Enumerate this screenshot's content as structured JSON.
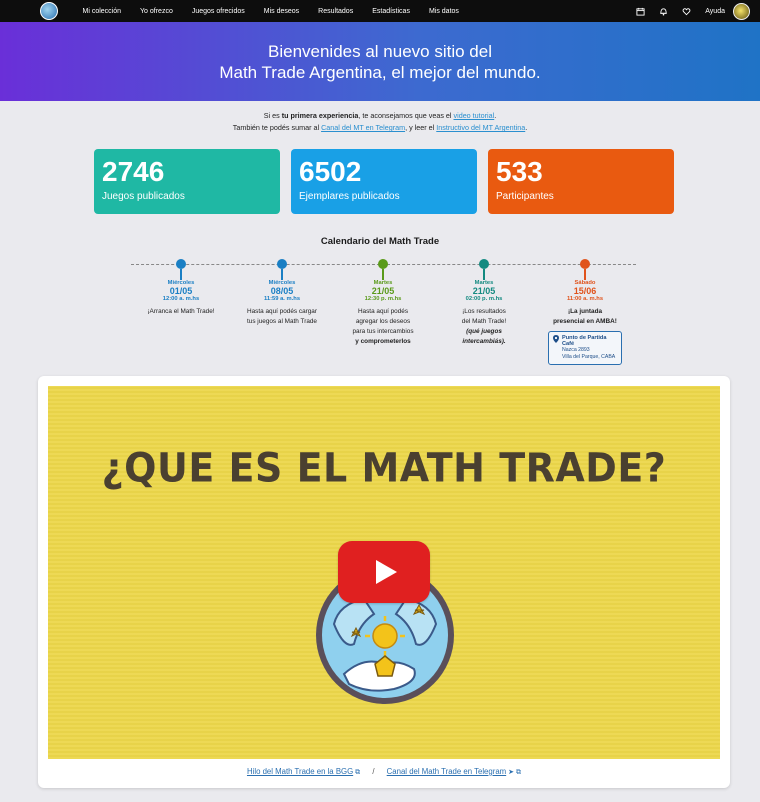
{
  "nav": {
    "items": [
      {
        "label": "Mi colección"
      },
      {
        "label": "Yo ofrezco"
      },
      {
        "label": "Juegos ofrecidos"
      },
      {
        "label": "Mis deseos"
      },
      {
        "label": "Resultados"
      },
      {
        "label": "Estadísticas"
      },
      {
        "label": "Mis datos"
      }
    ],
    "help_label": "Ayuda",
    "icons": [
      "calendar-icon",
      "bell-icon",
      "heart-icon"
    ]
  },
  "hero": {
    "line1": "Bienvenides al nuevo sitio del",
    "line2": "Math Trade Argentina, el mejor del mundo."
  },
  "intro": {
    "l1_a": "Si es ",
    "l1_b": "tu primera experiencia",
    "l1_c": ", te aconsejamos que veas el ",
    "l1_link": "video tutorial",
    "l1_d": ".",
    "l2_a": "También te podés sumar al ",
    "l2_link1": "Canal del MT en Telegram",
    "l2_b": ", y leer el ",
    "l2_link2": "Instructivo del MT Argentina",
    "l2_c": "."
  },
  "stats": [
    {
      "value": "2746",
      "label": "Juegos publicados",
      "color": "#1fb8a4"
    },
    {
      "value": "6502",
      "label": "Ejemplares publicados",
      "color": "#19a0e6"
    },
    {
      "value": "533",
      "label": "Participantes",
      "color": "#e95a10"
    }
  ],
  "calendar": {
    "title": "Calendario del Math Trade",
    "events": [
      {
        "day": "Miércoles",
        "date": "01/05",
        "time": "12:00 a. m.hs",
        "color": "#1a7fc4",
        "desc1": "¡Arranca el Math Trade!"
      },
      {
        "day": "Miércoles",
        "date": "08/05",
        "time": "11:59 a. m.hs",
        "color": "#1a7fc4",
        "desc1": "Hasta aquí podés cargar",
        "desc2": "tus juegos al Math Trade"
      },
      {
        "day": "Martes",
        "date": "21/05",
        "time": "12:30 p. m.hs",
        "color": "#5a9a1a",
        "desc1": "Hasta aquí podés",
        "desc2": "agregar los deseos",
        "desc3": "para tus intercambios",
        "desc4": "y comprometerlos"
      },
      {
        "day": "Martes",
        "date": "21/05",
        "time": "02:00 p. m.hs",
        "color": "#138a80",
        "desc1": "¡Los resultados",
        "desc2": "del Math Trade!",
        "desc3": "(qué juegos",
        "desc4": "intercambiás)."
      },
      {
        "day": "Sábado",
        "date": "15/06",
        "time": "11:00 a. m.hs",
        "color": "#e0531c",
        "desc1": "¡La juntada",
        "desc2": "presencial en AMBA!",
        "loc_name": "Punto de Partida Café",
        "loc_addr1": "Nazca 2893",
        "loc_addr2": "Villa del Parque, CABA"
      }
    ]
  },
  "video": {
    "title": "¿QUE ES EL MATH TRADE?"
  },
  "links": {
    "bgg": "Hilo del Math Trade en la BGG",
    "separator": "/",
    "telegram": "Canal del Math Trade en Telegram"
  }
}
